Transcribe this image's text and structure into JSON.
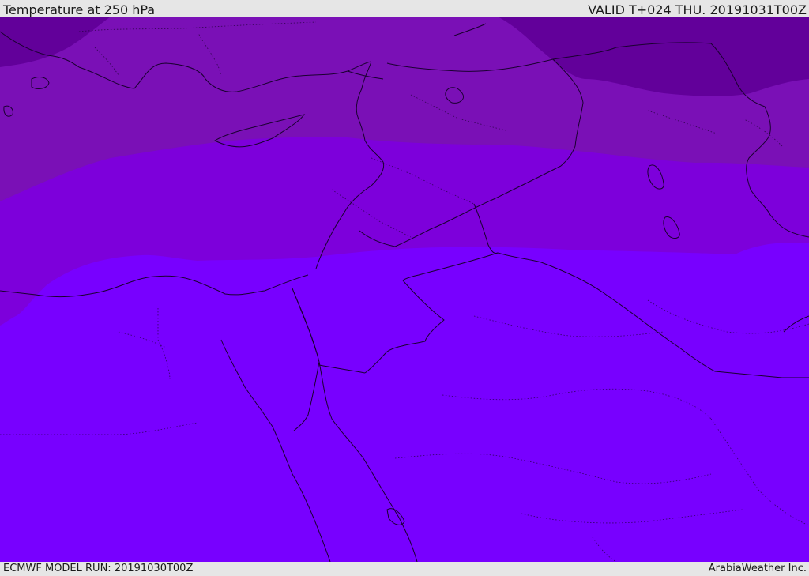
{
  "header": {
    "title": "Temperature at 250 hPa",
    "valid": "VALID T+024 THU. 20191031T00Z"
  },
  "footer": {
    "model_run": "ECMWF MODEL RUN: 20191030T00Z",
    "credit": "ArabiaWeather Inc."
  },
  "colors": {
    "band_coldest": "#62009a",
    "band_cold": "#7a10b6",
    "band_mid": "#7d00db",
    "band_warm": "#7800ff",
    "coastline": "#1a0030",
    "border": "#1a0030",
    "bar_background": "#e6e6e6"
  }
}
